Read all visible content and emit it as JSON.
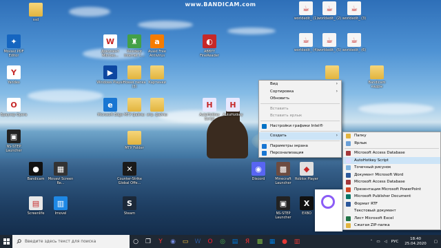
{
  "watermark": "www.BANDICAM.com",
  "desktop_icons": [
    {
      "label": "ssd",
      "kind": "folder",
      "color": "#e2b43f"
    },
    {
      "label": "Movavi PDF Editor",
      "kind": "app",
      "color": "#1565c0",
      "glyph": "✦"
    },
    {
      "label": "Yandex",
      "kind": "app",
      "color": "#ffffff",
      "glyph": "Y"
    },
    {
      "label": "Браузер Opera",
      "kind": "app",
      "color": "#ffffff",
      "glyph": "O"
    },
    {
      "label": "NS-STEP Launcher",
      "kind": "app",
      "color": "#222222",
      "glyph": "▣"
    },
    {
      "label": "Bandicam",
      "kind": "app",
      "color": "#111111",
      "glyph": "●"
    },
    {
      "label": "Screenlife",
      "kind": "app",
      "color": "#e8e8e8",
      "glyph": "▤"
    },
    {
      "label": "Movavi Screen Re...",
      "kind": "app",
      "color": "#333333",
      "glyph": "▦"
    },
    {
      "label": "Imovel",
      "kind": "app",
      "color": "#1e88e5",
      "glyph": "▥"
    },
    {
      "label": "Документ Microso...",
      "kind": "app",
      "color": "#ffffff",
      "glyph": "W"
    },
    {
      "label": "Windows Player",
      "kind": "app",
      "color": "#0d47a1",
      "glyph": "▶"
    },
    {
      "label": "Microsoft Edge",
      "kind": "app",
      "color": "#1976d2",
      "glyph": "e"
    },
    {
      "label": "Resident Internet C...",
      "kind": "app",
      "color": "#43a047",
      "glyph": "♜"
    },
    {
      "label": "Новая папка (3)",
      "kind": "folder",
      "color": "#e2b43f"
    },
    {
      "label": "МГУ файлы",
      "kind": "folder",
      "color": "#e2b43f"
    },
    {
      "label": "МГУ Folder",
      "kind": "folder",
      "color": "#e2b43f"
    },
    {
      "label": "Avast Free Antivirus",
      "kind": "app",
      "color": "#f57c00",
      "glyph": "a"
    },
    {
      "label": "Картинки",
      "kind": "folder",
      "color": "#e2b43f"
    },
    {
      "label": "игр. файлы",
      "kind": "folder",
      "color": "#e2b43f"
    },
    {
      "label": "ABBYY FineReader",
      "kind": "app",
      "color": "#c62828",
      "glyph": "◐"
    },
    {
      "label": "AutoHotkey Script",
      "kind": "app",
      "color": "#e8e8ff",
      "glyph": "H"
    },
    {
      "label": "AutoHotkey",
      "kind": "app",
      "color": "#e8e8ff",
      "glyph": "H"
    },
    {
      "label": "Counter-Strike Global Offe...",
      "kind": "app",
      "color": "#1a1a1a",
      "glyph": "✕"
    },
    {
      "label": "Steam",
      "kind": "app",
      "color": "#1b2838",
      "glyph": "S"
    },
    {
      "label": "Discord",
      "kind": "app",
      "color": "#5865f2",
      "glyph": "◉"
    },
    {
      "label": "Minecraft Launcher",
      "kind": "app",
      "color": "#6d4c41",
      "glyph": "▩"
    },
    {
      "label": "Roblox Player",
      "kind": "app",
      "color": "#e0e0e0",
      "glyph": "◆"
    },
    {
      "label": "NS-STEP Launcher",
      "kind": "app",
      "color": "#222222",
      "glyph": "▣"
    },
    {
      "label": "EXBO",
      "kind": "app",
      "color": "#111111",
      "glyph": "X"
    },
    {
      "label": "Bandicam кадры",
      "kind": "folder",
      "color": "#e2b43f"
    },
    {
      "label": "worldedit_ (1)",
      "kind": "app",
      "color": "#f5f5f5",
      "glyph": "☕"
    },
    {
      "label": "worldedit_ (2)",
      "kind": "app",
      "color": "#f5f5f5",
      "glyph": "☕"
    },
    {
      "label": "worldedit_ (3)",
      "kind": "app",
      "color": "#f5f5f5",
      "glyph": "☕"
    },
    {
      "label": "worldedit_ (4)",
      "kind": "app",
      "color": "#f5f5f5",
      "glyph": "☕"
    },
    {
      "label": "worldedit_ (5)",
      "kind": "app",
      "color": "#f5f5f5",
      "glyph": "☕"
    },
    {
      "label": "worldedit_ (6)",
      "kind": "app",
      "color": "#f5f5f5",
      "glyph": "☕"
    },
    {
      "label": "",
      "kind": "folder",
      "color": "#e2b43f"
    }
  ],
  "context_menu": [
    {
      "label": "Вид",
      "submenu": true
    },
    {
      "label": "Сортировка",
      "submenu": true
    },
    {
      "label": "Обновить"
    },
    {
      "sep": true
    },
    {
      "label": "Вставить",
      "disabled": true
    },
    {
      "label": "Вставить ярлык",
      "disabled": true
    },
    {
      "sep": true
    },
    {
      "label": "Настройки графики Intel®",
      "icon_color": "#0071c5"
    },
    {
      "sep": true
    },
    {
      "label": "Создать",
      "submenu": true,
      "highlight": true
    },
    {
      "sep": true
    },
    {
      "label": "Параметры экрана",
      "icon_color": "#1976d2"
    },
    {
      "label": "Персонализация",
      "icon_color": "#1976d2"
    }
  ],
  "submenu": [
    {
      "label": "Папку",
      "icon_color": "#e2b43f"
    },
    {
      "label": "Ярлык",
      "icon_color": "#6aa0d8"
    },
    {
      "sep": true
    },
    {
      "label": "Microsoft Access Database",
      "icon_color": "#a4373a"
    },
    {
      "label": "AutoHotkey Script",
      "icon_color": "#dcdcff",
      "highlight": true
    },
    {
      "label": "Точечный рисунок",
      "icon_color": "#7fb3e0"
    },
    {
      "label": "Документ Microsoft Word",
      "icon_color": "#2b579a"
    },
    {
      "label": "Microsoft Access Database",
      "icon_color": "#a4373a"
    },
    {
      "label": "Презентация Microsoft PowerPoint",
      "icon_color": "#d24726"
    },
    {
      "label": "Microsoft Publisher Document",
      "icon_color": "#077568"
    },
    {
      "label": "Формат RTF",
      "icon_color": "#2b579a"
    },
    {
      "label": "Текстовый документ",
      "icon_color": "#f0f0f0"
    },
    {
      "label": "Лист Microsoft Excel",
      "icon_color": "#217346"
    },
    {
      "label": "Сжатая ZIP-папка",
      "icon_color": "#e2b43f"
    }
  ],
  "taskbar": {
    "search_placeholder": "Введите здесь текст для поиска",
    "apps": [
      {
        "name": "cortana-icon",
        "glyph": "○",
        "color": "#ffffff"
      },
      {
        "name": "task-view-icon",
        "glyph": "❐",
        "color": "#ffffff"
      },
      {
        "name": "yandex-browser-icon",
        "glyph": "Y",
        "color": "#ff3333"
      },
      {
        "name": "discord-icon",
        "glyph": "◉",
        "color": "#7289da"
      },
      {
        "name": "file-explorer-icon",
        "glyph": "▭",
        "color": "#f5c542"
      },
      {
        "name": "word-icon",
        "glyph": "W",
        "color": "#2b579a"
      },
      {
        "name": "opera-icon",
        "glyph": "O",
        "color": "#ff1b2d"
      },
      {
        "name": "chrome-icon",
        "glyph": "◎",
        "color": "#4caf50"
      },
      {
        "name": "store-icon",
        "glyph": "▤",
        "color": "#0078d7"
      },
      {
        "name": "yandex-icon",
        "glyph": "Я",
        "color": "#ff3333"
      },
      {
        "name": "minecraft-icon",
        "glyph": "▩",
        "color": "#7cb342"
      },
      {
        "name": "photos-icon",
        "glyph": "▦",
        "color": "#0078d7"
      },
      {
        "name": "bandicam-icon",
        "glyph": "●",
        "color": "#e53935"
      },
      {
        "name": "pdf-icon",
        "glyph": "▥",
        "color": "#e53935"
      }
    ],
    "language": "РУС",
    "time": "18:40",
    "date": "25.04.2020"
  }
}
